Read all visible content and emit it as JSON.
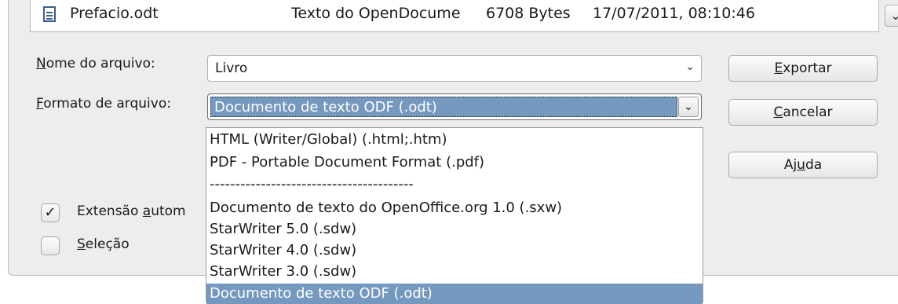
{
  "file_list": {
    "row": {
      "name": "Prefacio.odt",
      "type": "Texto do OpenDocume",
      "size": "6708 Bytes",
      "modified": "17/07/2011, 08:10:46"
    },
    "scroll_glyph": "⌄"
  },
  "form": {
    "filename_label_u": "N",
    "filename_label_rest": "ome do arquivo:",
    "filename_value": "Livro",
    "format_label_u": "F",
    "format_label_rest": "ormato de arquivo:",
    "format_value": "Documento de texto ODF (.odt)",
    "dropdown_glyph": "⌄"
  },
  "buttons": {
    "export_u": "E",
    "export_rest": "xportar",
    "cancel_u": "C",
    "cancel_rest": "ancelar",
    "help_pre": "Aj",
    "help_u": "u",
    "help_rest": "da"
  },
  "options": {
    "auto_ext_pre": "Extensão ",
    "auto_ext_u": "a",
    "auto_ext_rest": "utom",
    "auto_ext_checked": true,
    "check_glyph": "✓",
    "selection_u": "S",
    "selection_rest": "eleção",
    "selection_checked": false
  },
  "format_list": [
    "HTML (Writer/Global) (.html;.htm)",
    "PDF - Portable Document Format (.pdf)",
    "----------------------------------------",
    "Documento de texto do OpenOffice.org 1.0 (.sxw)",
    "StarWriter 5.0 (.sdw)",
    "StarWriter 4.0 (.sdw)",
    "StarWriter 3.0 (.sdw)",
    "Documento de texto ODF (.odt)"
  ],
  "colors": {
    "highlight": "#7598bf",
    "dialog_bg": "#ededed"
  }
}
